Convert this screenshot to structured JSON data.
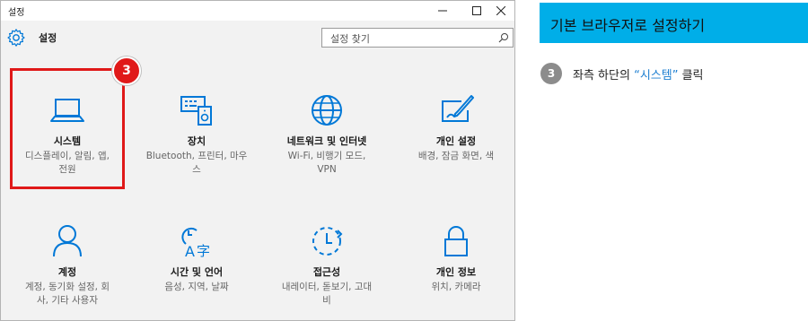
{
  "window": {
    "title": "설정"
  },
  "header": {
    "app_title": "설정",
    "search_placeholder": "설정 찾기"
  },
  "tiles": [
    {
      "label": "시스템",
      "desc": [
        "디스플레이, 알림, 앱,",
        "전원"
      ],
      "icon": "laptop-icon"
    },
    {
      "label": "장치",
      "desc": [
        "Bluetooth, 프린터, 마우",
        "스"
      ],
      "icon": "devices-icon"
    },
    {
      "label": "네트워크 및 인터넷",
      "desc": [
        "Wi-Fi, 비행기 모드,",
        "VPN"
      ],
      "icon": "globe-icon"
    },
    {
      "label": "개인 설정",
      "desc": [
        "배경, 잠금 화면, 색"
      ],
      "icon": "personalization-icon"
    },
    {
      "label": "계정",
      "desc": [
        "계정, 동기화 설정, 회",
        "사, 기타 사용자"
      ],
      "icon": "account-icon"
    },
    {
      "label": "시간 및 언어",
      "desc": [
        "음성, 지역, 날짜"
      ],
      "icon": "time-language-icon"
    },
    {
      "label": "접근성",
      "desc": [
        "내레이터, 돋보기, 고대",
        "비"
      ],
      "icon": "ease-of-access-icon"
    },
    {
      "label": "개인 정보",
      "desc": [
        "위치, 카메라"
      ],
      "icon": "lock-icon"
    }
  ],
  "step_badge": "3",
  "panel": {
    "title": "기본 브라우저로 설정하기",
    "step_num": "3",
    "step_text_pre": "좌측 하단의 ",
    "step_text_highlight": "“시스템”",
    "step_text_post": " 클릭"
  },
  "colors": {
    "accent": "#0078d7",
    "highlight": "#e01919",
    "panel_bg": "#00aee8",
    "step_circle": "#8c8c8c"
  }
}
